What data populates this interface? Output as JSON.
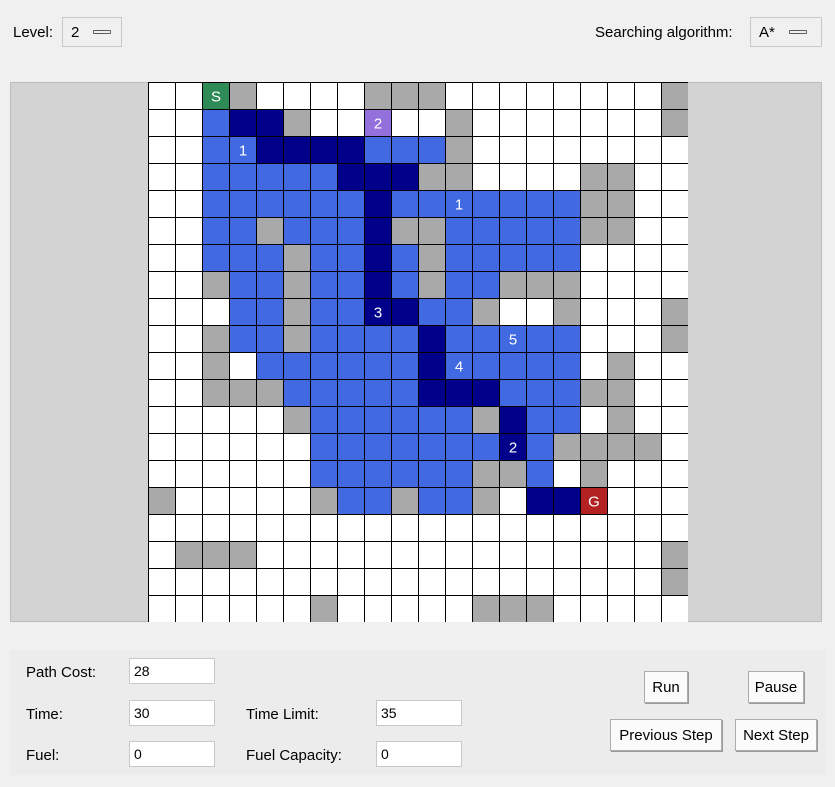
{
  "controls": {
    "level_label": "Level:",
    "level_value": "2",
    "algorithm_label": "Searching algorithm:",
    "algorithm_value": "A*"
  },
  "grid": {
    "rows": 20,
    "cols": 20,
    "colors": {
      "empty": "#ffffff",
      "wall": "#a9a9a9",
      "explored": "#4169e1",
      "path": "#00008b",
      "start": "#2e8b57",
      "goal": "#b22222",
      "fuel_station": "#9370db",
      "line": "#000000",
      "text": "#ffffff"
    },
    "cells": [
      "..S#....###........#",
      "..EPP#..F..#.......#",
      "..EEPPPPEEE#........",
      "..EEEEEPPP##....##..",
      "..EEEEEEPEEEEEEE##..",
      "..EE#EEEP##EEEEE##..",
      "..EEE#EEPE#EEEEE....",
      "..#EE#EEPE#EE###....",
      "...EE#EEPPEE#..#...#",
      "..#EE#EEEEPEEEEE...#",
      "..#.EEEEEEPEEEEE.#..",
      "..###EEEEEPPPEEE##..",
      ".....#EEEEEE#PEE.#..",
      "......EEEEEEEPE####.",
      "......EEEEEE##E.#...",
      "#.....#EE#EE#.PPG...",
      "....................",
      ".###...............#",
      "...................#",
      "......#.....###....."
    ],
    "labels": [
      {
        "row": 0,
        "col": 2,
        "text": "S"
      },
      {
        "row": 1,
        "col": 8,
        "text": "2"
      },
      {
        "row": 2,
        "col": 3,
        "text": "1"
      },
      {
        "row": 4,
        "col": 11,
        "text": "1"
      },
      {
        "row": 8,
        "col": 8,
        "text": "3"
      },
      {
        "row": 9,
        "col": 13,
        "text": "5"
      },
      {
        "row": 10,
        "col": 11,
        "text": "4"
      },
      {
        "row": 13,
        "col": 13,
        "text": "2"
      },
      {
        "row": 15,
        "col": 16,
        "text": "G"
      }
    ]
  },
  "stats": {
    "path_cost_label": "Path Cost:",
    "path_cost": "28",
    "time_label": "Time:",
    "time": "30",
    "time_limit_label": "Time Limit:",
    "time_limit": "35",
    "fuel_label": "Fuel:",
    "fuel": "0",
    "fuel_capacity_label": "Fuel Capacity:",
    "fuel_capacity": "0"
  },
  "buttons": {
    "run": "Run",
    "pause": "Pause",
    "previous_step": "Previous Step",
    "next_step": "Next Step"
  }
}
